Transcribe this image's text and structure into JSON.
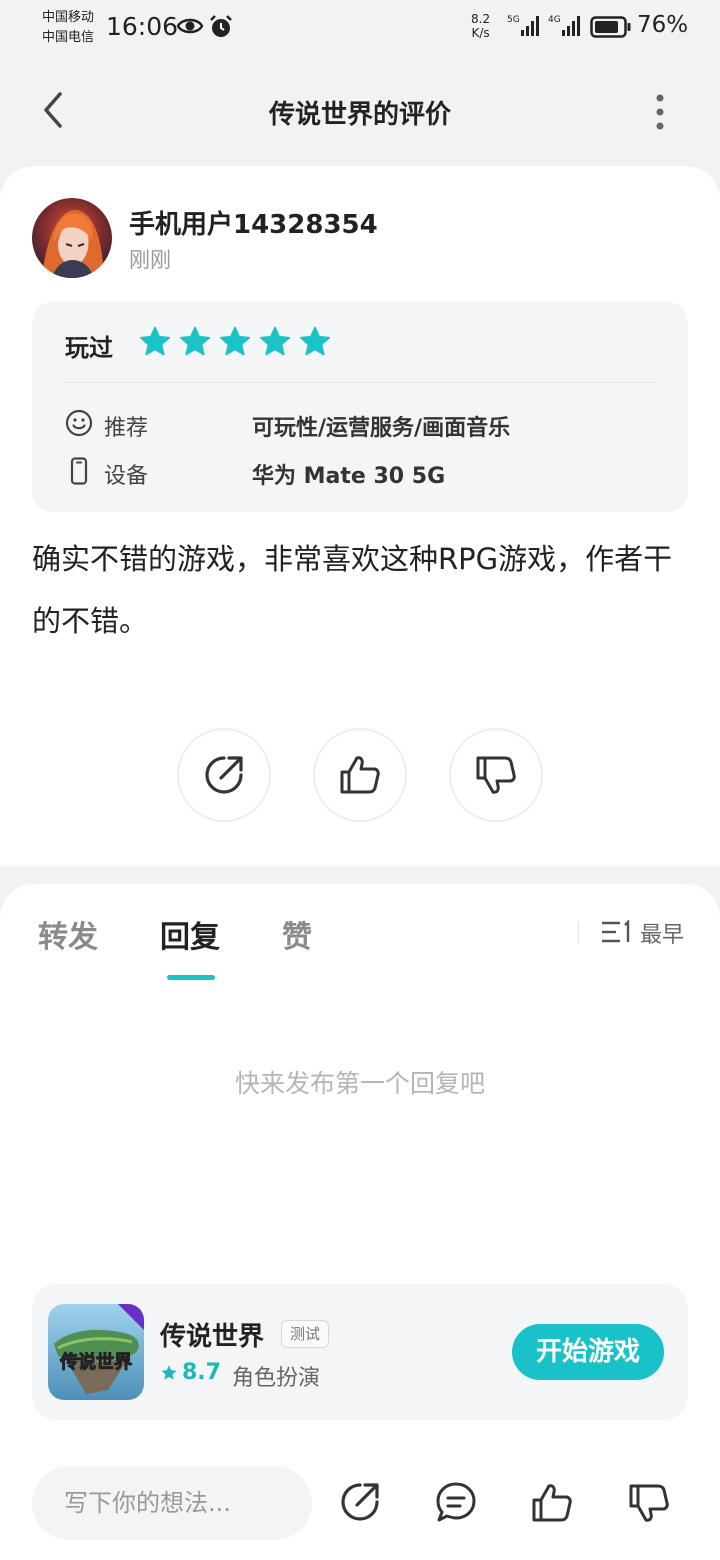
{
  "status_bar": {
    "carrier_1": "中国移动",
    "carrier_2": "中国电信",
    "time": "16:06",
    "speed_value": "8.2",
    "speed_unit": "K/s",
    "signal_1_label": "5G",
    "signal_2_label": "4G",
    "battery": "76%"
  },
  "header": {
    "title": "传说世界的评价"
  },
  "review": {
    "user_name": "手机用户14328354",
    "time": "刚刚",
    "played_label": "玩过",
    "stars": 5,
    "recommend_label": "推荐",
    "recommend_value": "可玩性/运营服务/画面音乐",
    "device_label": "设备",
    "device_value": "华为 Mate 30 5G",
    "text": "确实不错的游戏，非常喜欢这种RPG游戏，作者干的不错。"
  },
  "tabs": {
    "forward": "转发",
    "reply": "回复",
    "like": "赞",
    "active": "回复"
  },
  "sort": {
    "label": "最早"
  },
  "empty_hint": "快来发布第一个回复吧",
  "game": {
    "name": "传说世界",
    "tag": "测试",
    "score": "8.7",
    "genre": "角色扮演",
    "play_label": "开始游戏"
  },
  "bottom_bar": {
    "input_placeholder": "写下你的想法..."
  },
  "colors": {
    "accent": "#19c2c9",
    "star": "#1bc3c9"
  }
}
